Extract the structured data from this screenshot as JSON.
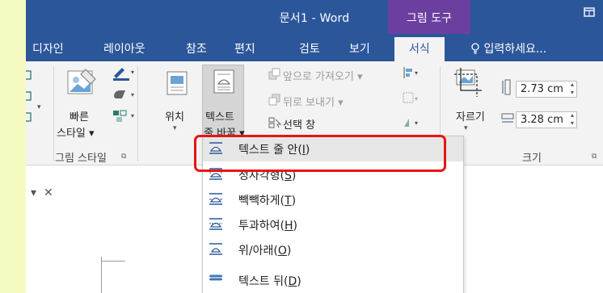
{
  "titlebar": {
    "doc_title": "문서1 - Word",
    "context_tab_header": "그림 도구",
    "window_icon": "restore-icon"
  },
  "tabs": [
    {
      "label": "디자인"
    },
    {
      "label": "레이아웃"
    },
    {
      "label": "참조"
    },
    {
      "label": "편지"
    },
    {
      "label": "검토"
    },
    {
      "label": "보기"
    },
    {
      "label": "서식"
    }
  ],
  "active_tab": "서식",
  "tell_me": {
    "icon": "lightbulb-icon",
    "text": "입력하세요..."
  },
  "ribbon": {
    "quick_styles": {
      "line1": "빠른",
      "line2": "스타일"
    },
    "picture_styles_label": "그림 스타일",
    "position_label": "위치",
    "wrap_text": {
      "line1": "텍스트",
      "line2": "줄 바꿈"
    },
    "bring_forward": "앞으로 가져오기",
    "send_backward": "뒤로 보내기",
    "selection_pane": "선택 창",
    "crop_label": "자르기",
    "height_value": "2.73 cm",
    "width_value": "3.28 cm",
    "size_label": "크기"
  },
  "wrap_menu": {
    "items": [
      {
        "label": "텍스트 줄 안",
        "mnemonic": "I",
        "highlighted": true
      },
      {
        "label": "정사각형",
        "mnemonic": "S",
        "highlighted": false
      },
      {
        "label": "빽빽하게",
        "mnemonic": "T",
        "highlighted": false
      },
      {
        "label": "투과하여",
        "mnemonic": "H",
        "highlighted": false
      },
      {
        "label": "위/아래",
        "mnemonic": "O",
        "highlighted": false
      },
      {
        "label": "텍스트 뒤",
        "mnemonic": "D",
        "highlighted": false
      }
    ]
  },
  "pane_controls": {
    "dropdown": "▾",
    "close": "✕"
  },
  "colors": {
    "accent_blue": "#2b579a",
    "picture_tools_purple": "#6b3fa0",
    "highlight_red": "#e81414",
    "page_bg": "#f5fbc0"
  }
}
